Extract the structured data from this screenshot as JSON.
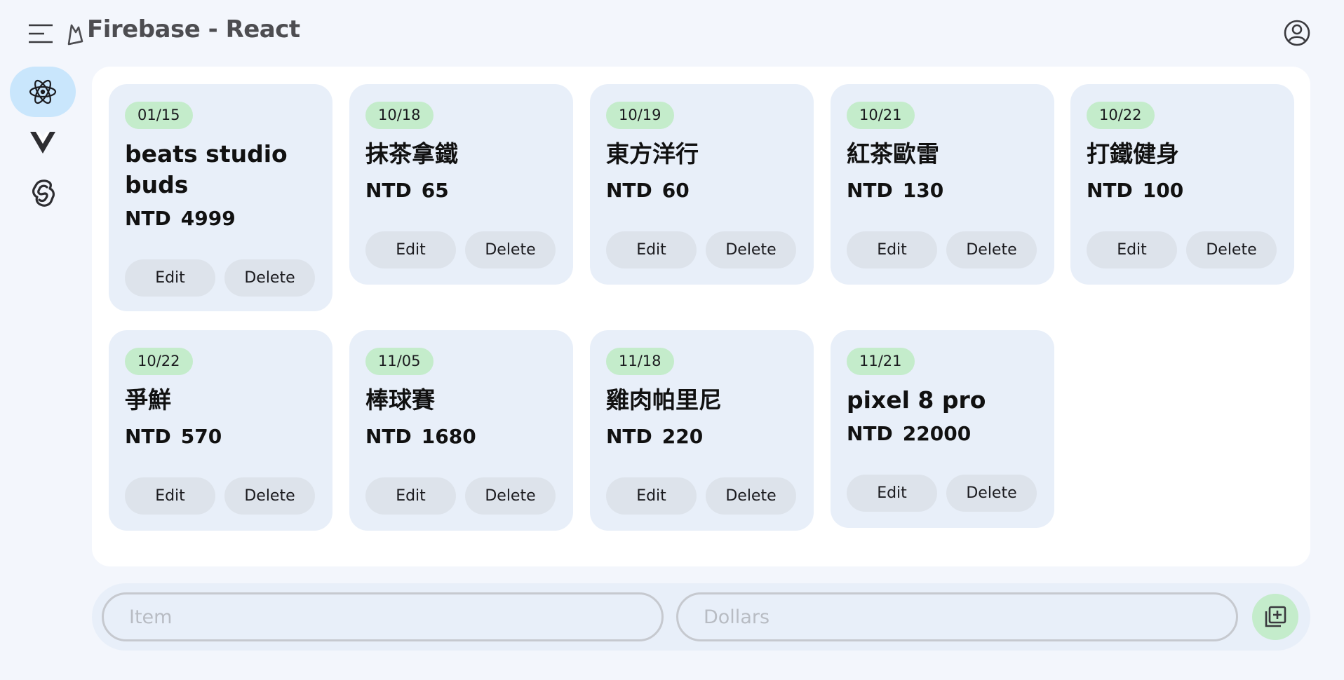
{
  "app": {
    "title": "Firebase - React"
  },
  "rail": {
    "items": [
      {
        "name": "react-icon",
        "active": true
      },
      {
        "name": "vue-icon",
        "active": false
      },
      {
        "name": "svelte-icon",
        "active": false
      }
    ]
  },
  "expenses": [
    {
      "date": "01/15",
      "item": "beats studio buds",
      "currency": "NTD",
      "amount": "4999"
    },
    {
      "date": "10/18",
      "item": "抹茶拿鐵",
      "currency": "NTD",
      "amount": "65"
    },
    {
      "date": "10/19",
      "item": "東方洋行",
      "currency": "NTD",
      "amount": "60"
    },
    {
      "date": "10/21",
      "item": "紅茶歐雷",
      "currency": "NTD",
      "amount": "130"
    },
    {
      "date": "10/22",
      "item": "打鐵健身",
      "currency": "NTD",
      "amount": "100"
    },
    {
      "date": "10/22",
      "item": "爭鮮",
      "currency": "NTD",
      "amount": "570"
    },
    {
      "date": "11/05",
      "item": "棒球賽",
      "currency": "NTD",
      "amount": "1680"
    },
    {
      "date": "11/18",
      "item": "雞肉帕里尼",
      "currency": "NTD",
      "amount": "220"
    },
    {
      "date": "11/21",
      "item": "pixel 8 pro",
      "currency": "NTD",
      "amount": "22000"
    }
  ],
  "actions": {
    "edit_label": "Edit",
    "delete_label": "Delete"
  },
  "form": {
    "item_placeholder": "Item",
    "dollars_placeholder": "Dollars",
    "item_value": "",
    "dollars_value": ""
  },
  "colors": {
    "background": "#f3f6fc",
    "card": "#e8eff9",
    "chip": "#c4eccb",
    "active_rail": "#c9e6fc"
  }
}
